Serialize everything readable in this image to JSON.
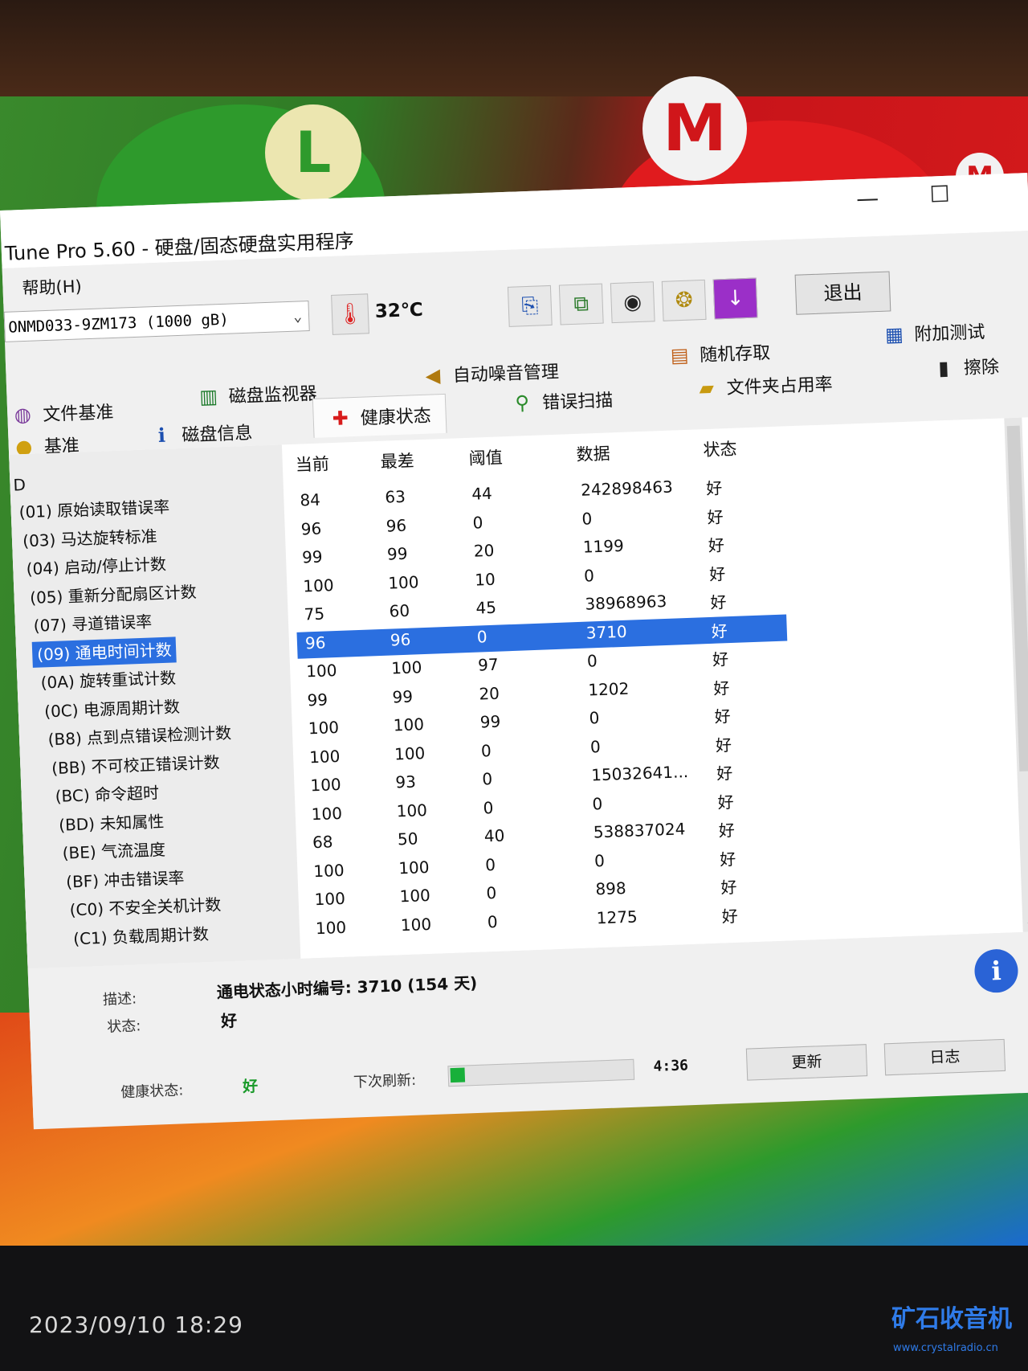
{
  "window": {
    "title": "Tune Pro 5.60 - 硬盘/固态硬盘实用程序",
    "minimize_glyph": "—",
    "maximize_glyph": "☐"
  },
  "menu": {
    "help": "帮助(H)"
  },
  "toolbar": {
    "drive": "ONMD033-9ZM173 (1000 gB)",
    "temperature": "32℃",
    "exit_label": "退出",
    "icons": [
      "copy-icon",
      "copy-screen-icon",
      "camera-icon",
      "coins-icon",
      "download-arrow-icon"
    ]
  },
  "tabs": {
    "row1": [
      {
        "label": "文件基准",
        "icon": "file-benchmark-icon"
      },
      {
        "label": "磁盘监视器",
        "icon": "disk-monitor-icon"
      },
      {
        "label": "自动噪音管理",
        "icon": "speaker-icon"
      },
      {
        "label": "随机存取",
        "icon": "random-access-icon"
      },
      {
        "label": "附加测试",
        "icon": "extra-tests-icon"
      }
    ],
    "row2": [
      {
        "label": "基准",
        "icon": "bulb-icon"
      },
      {
        "label": "磁盘信息",
        "icon": "info-icon"
      },
      {
        "label": "健康状态",
        "icon": "health-cross-icon",
        "active": true
      },
      {
        "label": "错误扫描",
        "icon": "magnifier-icon"
      },
      {
        "label": "文件夹占用率",
        "icon": "folder-icon"
      },
      {
        "label": "擦除",
        "icon": "trash-icon"
      }
    ]
  },
  "smart": {
    "id_header": "D",
    "columns": [
      "当前",
      "最差",
      "阈值",
      "数据",
      "状态"
    ],
    "rows": [
      {
        "attr": "(01) 原始读取错误率",
        "current": "84",
        "worst": "63",
        "threshold": "44",
        "data": "242898463",
        "status": "好"
      },
      {
        "attr": "(03) 马达旋转标准",
        "current": "96",
        "worst": "96",
        "threshold": "0",
        "data": "0",
        "status": "好"
      },
      {
        "attr": "(04) 启动/停止计数",
        "current": "99",
        "worst": "99",
        "threshold": "20",
        "data": "1199",
        "status": "好"
      },
      {
        "attr": "(05) 重新分配扇区计数",
        "current": "100",
        "worst": "100",
        "threshold": "10",
        "data": "0",
        "status": "好"
      },
      {
        "attr": "(07) 寻道错误率",
        "current": "75",
        "worst": "60",
        "threshold": "45",
        "data": "38968963",
        "status": "好"
      },
      {
        "attr": "(09) 通电时间计数",
        "current": "96",
        "worst": "96",
        "threshold": "0",
        "data": "3710",
        "status": "好",
        "selected": true
      },
      {
        "attr": "(0A) 旋转重试计数",
        "current": "100",
        "worst": "100",
        "threshold": "97",
        "data": "0",
        "status": "好"
      },
      {
        "attr": "(0C) 电源周期计数",
        "current": "99",
        "worst": "99",
        "threshold": "20",
        "data": "1202",
        "status": "好"
      },
      {
        "attr": "(B8) 点到点错误检测计数",
        "current": "100",
        "worst": "100",
        "threshold": "99",
        "data": "0",
        "status": "好"
      },
      {
        "attr": "(BB) 不可校正错误计数",
        "current": "100",
        "worst": "100",
        "threshold": "0",
        "data": "0",
        "status": "好"
      },
      {
        "attr": "(BC) 命令超时",
        "current": "100",
        "worst": "93",
        "threshold": "0",
        "data": "15032641...",
        "status": "好"
      },
      {
        "attr": "(BD) 未知属性",
        "current": "100",
        "worst": "100",
        "threshold": "0",
        "data": "0",
        "status": "好"
      },
      {
        "attr": "(BE) 气流温度",
        "current": "68",
        "worst": "50",
        "threshold": "40",
        "data": "538837024",
        "status": "好"
      },
      {
        "attr": "(BF) 冲击错误率",
        "current": "100",
        "worst": "100",
        "threshold": "0",
        "data": "0",
        "status": "好"
      },
      {
        "attr": "(C0) 不安全关机计数",
        "current": "100",
        "worst": "100",
        "threshold": "0",
        "data": "898",
        "status": "好"
      },
      {
        "attr": "(C1) 负载周期计数",
        "current": "100",
        "worst": "100",
        "threshold": "0",
        "data": "1275",
        "status": "好"
      }
    ]
  },
  "description": {
    "desc_label": "描述:",
    "desc_value": "通电状态小时编号: 3710 (154 天)",
    "status_label": "状态:",
    "status_value": "好"
  },
  "statusbar": {
    "health_label": "健康状态:",
    "health_value": "好",
    "next_refresh_label": "下次刷新:",
    "refresh_progress": 0.08,
    "countdown": "4:36",
    "refresh_button": "更新",
    "log_button": "日志"
  },
  "photo": {
    "timestamp": "2023/09/10 18:29",
    "watermark": "矿石收音机",
    "watermark_url": "www.crystalradio.cn"
  },
  "colors": {
    "selection": "#2b6fe0",
    "good_status": "#1a9a2a",
    "progress_fill": "#18b03a"
  }
}
